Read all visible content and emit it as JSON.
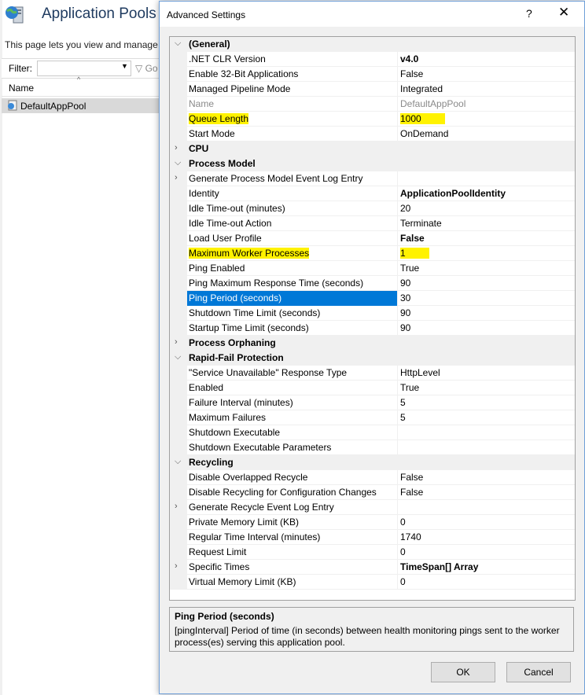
{
  "background_window": {
    "title": "Application Pools",
    "description": "This page lets you view and manage t",
    "filter_label": "Filter:",
    "go_label": "Go",
    "column_name": "Name",
    "pools": [
      "DefaultAppPool"
    ]
  },
  "dialog": {
    "title": "Advanced Settings",
    "help_glyph": "?",
    "close_glyph": "✕",
    "ok_label": "OK",
    "cancel_label": "Cancel",
    "description_title": "Ping Period (seconds)",
    "description_text": "[pingInterval] Period of time (in seconds) between health monitoring pings sent to the worker process(es) serving this application pool."
  },
  "rows": [
    {
      "type": "cat",
      "toggle": "⌵",
      "name": "(General)"
    },
    {
      "type": "prop",
      "name": ".NET CLR Version",
      "value": "v4.0",
      "bold": true
    },
    {
      "type": "prop",
      "name": "Enable 32-Bit Applications",
      "value": "False"
    },
    {
      "type": "prop",
      "name": "Managed Pipeline Mode",
      "value": "Integrated"
    },
    {
      "type": "prop",
      "name": "Name",
      "value": "DefaultAppPool",
      "disabled": true
    },
    {
      "type": "prop",
      "name": "Queue Length",
      "value": "1000",
      "highlight": true
    },
    {
      "type": "prop",
      "name": "Start Mode",
      "value": "OnDemand"
    },
    {
      "type": "cat",
      "toggle": "›",
      "name": "CPU"
    },
    {
      "type": "cat",
      "toggle": "⌵",
      "name": "Process Model"
    },
    {
      "type": "prop",
      "toggle": "›",
      "name": "Generate Process Model Event Log Entry",
      "value": ""
    },
    {
      "type": "prop",
      "name": "Identity",
      "value": "ApplicationPoolIdentity",
      "bold": true
    },
    {
      "type": "prop",
      "name": "Idle Time-out (minutes)",
      "value": "20"
    },
    {
      "type": "prop",
      "name": "Idle Time-out Action",
      "value": "Terminate"
    },
    {
      "type": "prop",
      "name": "Load User Profile",
      "value": "False",
      "bold": true
    },
    {
      "type": "prop",
      "name": "Maximum Worker Processes",
      "value": "1",
      "highlight": true
    },
    {
      "type": "prop",
      "name": "Ping Enabled",
      "value": "True"
    },
    {
      "type": "prop",
      "name": "Ping Maximum Response Time (seconds)",
      "value": "90"
    },
    {
      "type": "prop",
      "name": "Ping Period (seconds)",
      "value": "30",
      "selected": true
    },
    {
      "type": "prop",
      "name": "Shutdown Time Limit (seconds)",
      "value": "90"
    },
    {
      "type": "prop",
      "name": "Startup Time Limit (seconds)",
      "value": "90"
    },
    {
      "type": "cat",
      "toggle": "›",
      "name": "Process Orphaning"
    },
    {
      "type": "cat",
      "toggle": "⌵",
      "name": "Rapid-Fail Protection"
    },
    {
      "type": "prop",
      "name": "\"Service Unavailable\" Response Type",
      "value": "HttpLevel"
    },
    {
      "type": "prop",
      "name": "Enabled",
      "value": "True"
    },
    {
      "type": "prop",
      "name": "Failure Interval (minutes)",
      "value": "5"
    },
    {
      "type": "prop",
      "name": "Maximum Failures",
      "value": "5"
    },
    {
      "type": "prop",
      "name": "Shutdown Executable",
      "value": ""
    },
    {
      "type": "prop",
      "name": "Shutdown Executable Parameters",
      "value": ""
    },
    {
      "type": "cat",
      "toggle": "⌵",
      "name": "Recycling"
    },
    {
      "type": "prop",
      "name": "Disable Overlapped Recycle",
      "value": "False"
    },
    {
      "type": "prop",
      "name": "Disable Recycling for Configuration Changes",
      "value": "False"
    },
    {
      "type": "prop",
      "toggle": "›",
      "name": "Generate Recycle Event Log Entry",
      "value": ""
    },
    {
      "type": "prop",
      "name": "Private Memory Limit (KB)",
      "value": "0"
    },
    {
      "type": "prop",
      "name": "Regular Time Interval (minutes)",
      "value": "1740"
    },
    {
      "type": "prop",
      "name": "Request Limit",
      "value": "0"
    },
    {
      "type": "prop",
      "toggle": "›",
      "name": "Specific Times",
      "value": "TimeSpan[] Array",
      "bold": true
    },
    {
      "type": "prop",
      "name": "Virtual Memory Limit (KB)",
      "value": "0"
    }
  ]
}
